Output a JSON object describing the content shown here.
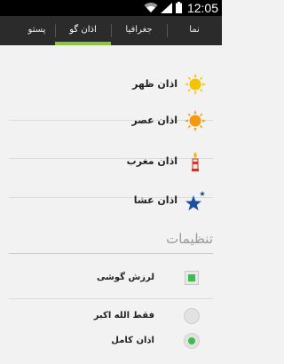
{
  "status_bar": {
    "time": "12:05"
  },
  "tabs": [
    {
      "label": "نما",
      "active": false
    },
    {
      "label": "جغرافیا",
      "active": false
    },
    {
      "label": "اذان گو",
      "active": true
    },
    {
      "label": "پستو",
      "active": false
    }
  ],
  "azan_list": [
    {
      "label": "اذان ظهر",
      "icon": "sun-icon"
    },
    {
      "label": "اذان عصر",
      "icon": "sun-orange-icon"
    },
    {
      "label": "اذان مغرب",
      "icon": "candle-icon"
    },
    {
      "label": "اذان عشا",
      "icon": "star-icon"
    }
  ],
  "settings": {
    "title": "تنظیمات",
    "vibrate_label": "لرزش گوشی",
    "vibrate_checked": true,
    "radio_options": [
      {
        "label": "فقط الله اکبر",
        "selected": false
      },
      {
        "label": "اذان کامل",
        "selected": true
      }
    ]
  },
  "colors": {
    "accent": "#8cc63f",
    "check": "#3cbf4a",
    "tabbar": "#2b2b2b"
  }
}
